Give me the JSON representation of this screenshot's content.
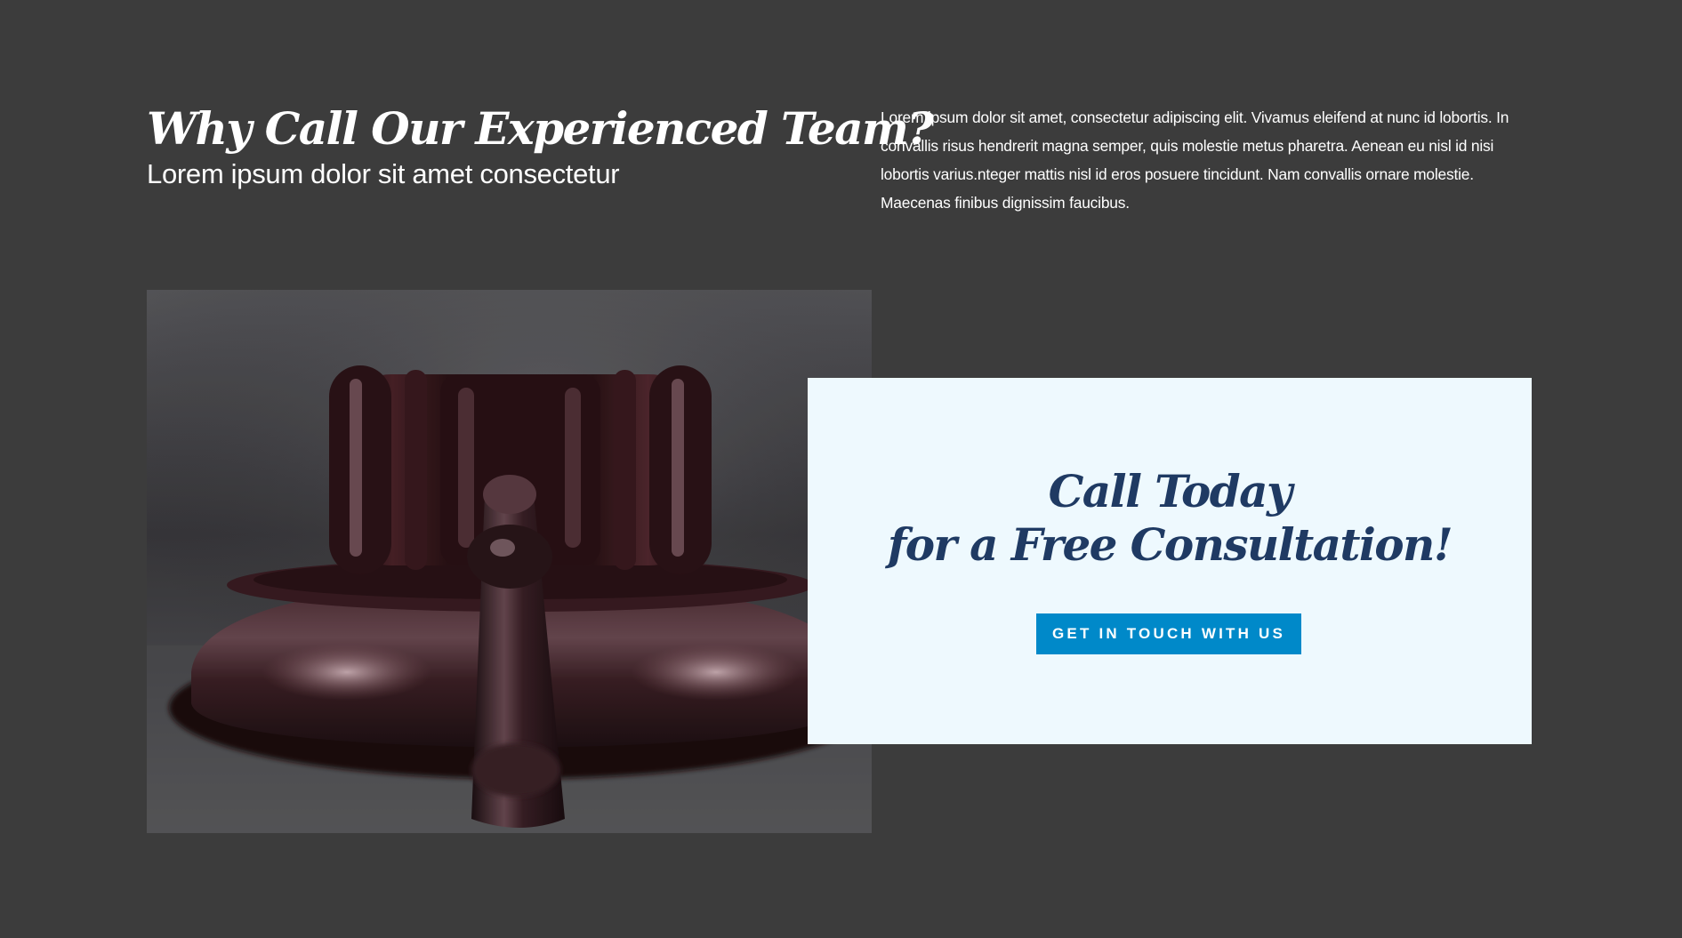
{
  "header": {
    "title": "Why Call Our Experienced Team?",
    "subtitle": "Lorem ipsum dolor sit amet consectetur"
  },
  "intro": {
    "paragraph": "Lorem ipsum dolor sit amet, consectetur adipiscing elit. Vivamus eleifend at nunc id lobortis. In convallis risus hendrerit magna semper, quis molestie metus pharetra. Aenean eu nisl id nisi lobortis varius.nteger mattis nisl id eros posuere tincidunt. Nam convallis ornare molestie. Maecenas finibus dignissim faucibus."
  },
  "image": {
    "subject": "gavel-on-sound-block"
  },
  "cta": {
    "title_line1": "Call Today",
    "title_line2": "for a Free Consultation!",
    "button_label": "Get in touch with us"
  },
  "colors": {
    "page_background": "#3c3c3c",
    "card_background": "#eef9fe",
    "heading_navy": "#1f3a63",
    "button_blue": "#0089c9",
    "text_white": "#ffffff"
  }
}
